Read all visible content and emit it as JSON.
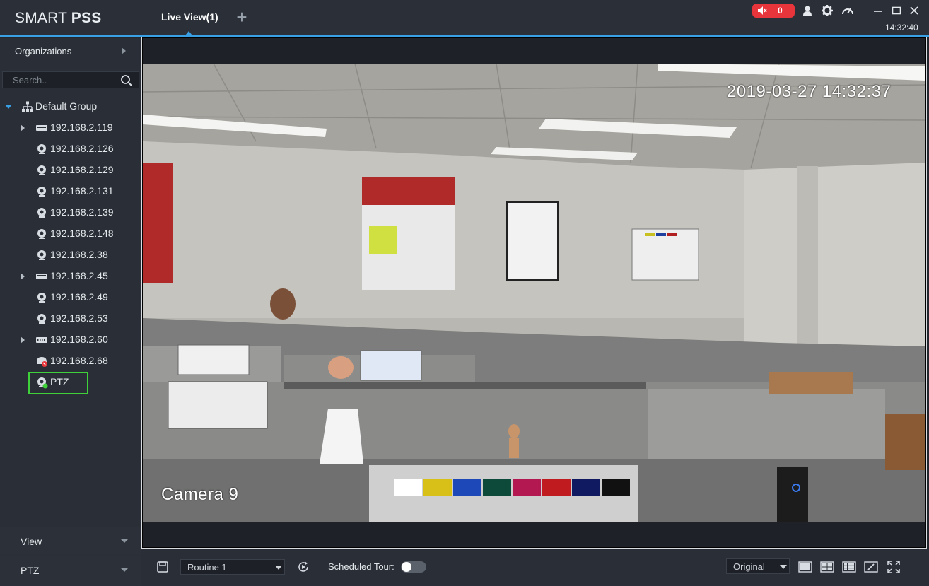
{
  "app": {
    "logo_light": "SMART ",
    "logo_bold": "PSS"
  },
  "tabs": [
    {
      "label": "Live View(1)",
      "active": true
    }
  ],
  "titlebar": {
    "add_tab_icon": "plus-icon",
    "alarm_count": "0",
    "alarm_color": "#e8353b",
    "icons": [
      "speaker-mute-icon",
      "user-icon",
      "gear-icon",
      "gauge-icon",
      "minimize-icon",
      "maximize-icon",
      "close-icon"
    ],
    "clock": "14:32:40",
    "accent_color": "#3aa0e6"
  },
  "sidebar": {
    "organizations_label": "Organizations",
    "search_placeholder": "Search..",
    "tree": {
      "group_label": "Default Group",
      "devices": [
        {
          "label": "192.168.2.119",
          "icon": "nvr-icon",
          "expandable": true
        },
        {
          "label": "192.168.2.126",
          "icon": "camera-icon",
          "expandable": false
        },
        {
          "label": "192.168.2.129",
          "icon": "camera-icon",
          "expandable": false
        },
        {
          "label": "192.168.2.131",
          "icon": "camera-icon",
          "expandable": false
        },
        {
          "label": "192.168.2.139",
          "icon": "camera-icon",
          "expandable": false
        },
        {
          "label": "192.168.2.148",
          "icon": "camera-icon",
          "expandable": false
        },
        {
          "label": "192.168.2.38",
          "icon": "camera-icon",
          "expandable": false
        },
        {
          "label": "192.168.2.45",
          "icon": "nvr-icon",
          "expandable": true
        },
        {
          "label": "192.168.2.49",
          "icon": "camera-icon",
          "expandable": false
        },
        {
          "label": "192.168.2.53",
          "icon": "camera-icon",
          "expandable": false
        },
        {
          "label": "192.168.2.60",
          "icon": "nvr-icon",
          "expandable": true
        },
        {
          "label": "192.168.2.68",
          "icon": "camera-offline-icon",
          "expandable": false
        },
        {
          "label": "PTZ",
          "icon": "camera-online-icon",
          "expandable": false,
          "selected": true
        }
      ]
    },
    "footer": [
      {
        "label": "View"
      },
      {
        "label": "PTZ"
      }
    ]
  },
  "video": {
    "osd_timestamp": "2019-03-27 14:32:37",
    "osd_camera_name": "Camera 9"
  },
  "bottombar": {
    "save_icon": "save-icon",
    "routine_value": "Routine 1",
    "refresh_icon": "refresh-icon",
    "scheduled_tour_label": "Scheduled Tour:",
    "scheduled_tour_on": false,
    "stream_value": "Original",
    "layout_icons": [
      "layout-1-icon",
      "layout-4-icon",
      "layout-9-icon",
      "custom-layout-icon",
      "fullscreen-icon"
    ]
  }
}
